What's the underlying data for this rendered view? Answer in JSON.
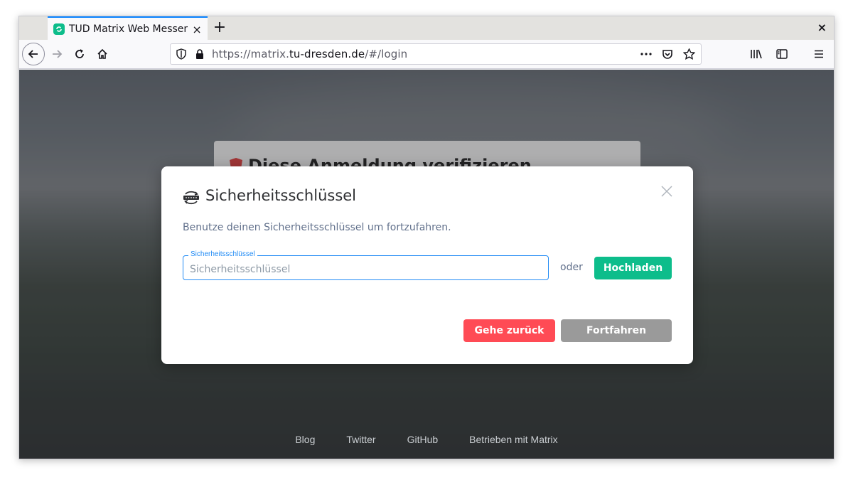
{
  "browser": {
    "tab_title": "TUD Matrix Web Messenger",
    "url_prefix": "https://matrix.",
    "url_host": "tu-dresden.de",
    "url_path": "/#/login",
    "new_tab_label": "+",
    "tab_close_label": "×",
    "window_close_label": "×"
  },
  "background": {
    "card_title": "Diese Anmeldung verifizieren"
  },
  "dialog": {
    "title": "Sicherheitsschlüssel",
    "description": "Benutze deinen Sicherheitsschlüssel um fortzufahren.",
    "field_label": "Sicherheitsschlüssel",
    "field_placeholder": "Sicherheitsschlüssel",
    "field_value": "",
    "or_label": "oder",
    "upload_label": "Hochladen",
    "back_label": "Gehe zurück",
    "continue_label": "Fortfahren"
  },
  "footer": {
    "links": [
      "Blog",
      "Twitter",
      "GitHub",
      "Betrieben mit Matrix"
    ]
  },
  "colors": {
    "accent_green": "#0dbd8b",
    "danger_red": "#ff4b55",
    "disabled_gray": "#9a9a9a",
    "focus_blue": "#238cf5"
  }
}
